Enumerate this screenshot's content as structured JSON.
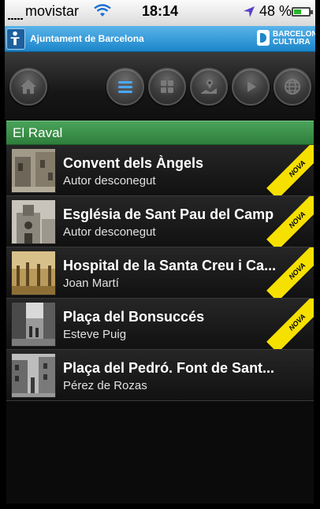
{
  "status_bar": {
    "carrier": "movistar",
    "time": "18:14",
    "battery_percent": "48 %",
    "battery_level": 0.48
  },
  "header": {
    "title": "Ajuntament de Barcelona",
    "culture_line1": "BARCELONA",
    "culture_line2": "CULTURA"
  },
  "toolbar": {
    "buttons": [
      {
        "icon": "home-icon",
        "active": false
      },
      {
        "icon": "list-icon",
        "active": true
      },
      {
        "icon": "grid-icon",
        "active": false
      },
      {
        "icon": "map-icon",
        "active": false
      },
      {
        "icon": "play-icon",
        "active": false
      },
      {
        "icon": "globe-icon",
        "active": false
      }
    ]
  },
  "section": {
    "title": "El Raval"
  },
  "items": [
    {
      "title": "Convent dels Àngels",
      "author": "Autor desconegut",
      "badge": "NOVA"
    },
    {
      "title": "Església de Sant Pau del Camp",
      "author": "Autor desconegut",
      "badge": "NOVA"
    },
    {
      "title": "Hospital de la Santa Creu i Ca...",
      "author": "Joan Martí",
      "badge": "NOVA"
    },
    {
      "title": "Plaça del Bonsuccés",
      "author": "Esteve Puig",
      "badge": "NOVA"
    },
    {
      "title": "Plaça del Pedró. Font de Sant...",
      "author": "Pérez de Rozas",
      "badge": ""
    }
  ],
  "colors": {
    "header_blue": "#2a92d4",
    "section_green": "#3a8f48",
    "badge_yellow": "#f5e000",
    "active_icon_blue": "#4aa8ff"
  }
}
